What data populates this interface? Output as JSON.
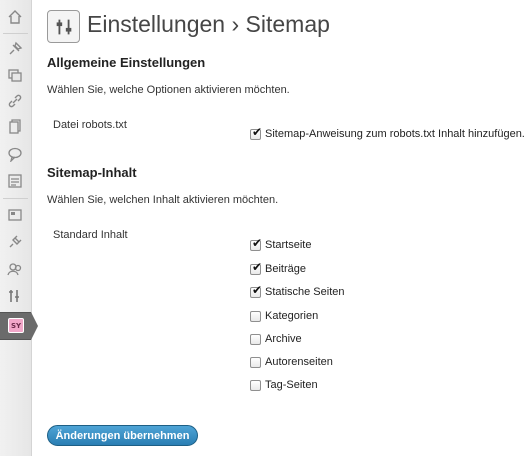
{
  "header": {
    "title": "Einstellungen › Sitemap",
    "icon": "sliders-icon"
  },
  "sidebar": {
    "items": [
      {
        "name": "dashboard",
        "icon": "home-icon"
      },
      {
        "name": "posts",
        "icon": "pin-icon"
      },
      {
        "name": "media",
        "icon": "media-icon"
      },
      {
        "name": "links",
        "icon": "link-icon"
      },
      {
        "name": "pages",
        "icon": "pages-icon"
      },
      {
        "name": "comments",
        "icon": "comment-icon"
      },
      {
        "name": "forms",
        "icon": "form-icon"
      },
      {
        "name": "appearance",
        "icon": "appearance-icon"
      },
      {
        "name": "plugins",
        "icon": "plugin-icon"
      },
      {
        "name": "users",
        "icon": "users-icon"
      },
      {
        "name": "tools",
        "icon": "tools-icon"
      },
      {
        "name": "settings",
        "icon": "settings-icon",
        "active": true
      }
    ]
  },
  "general": {
    "title": "Allgemeine Einstellungen",
    "description": "Wählen Sie, welche Optionen aktivieren möchten.",
    "robots_label": "Datei robots.txt",
    "robots_option": {
      "label": "Sitemap-Anweisung zum robots.txt Inhalt hinzufügen.",
      "checked": true
    }
  },
  "content": {
    "title": "Sitemap-Inhalt",
    "description": "Wählen Sie, welchen Inhalt aktivieren möchten.",
    "standard_label": "Standard Inhalt",
    "options": [
      {
        "label": "Startseite",
        "checked": true
      },
      {
        "label": "Beiträge",
        "checked": true
      },
      {
        "label": "Statische Seiten",
        "checked": true
      },
      {
        "label": "Kategorien",
        "checked": false
      },
      {
        "label": "Archive",
        "checked": false
      },
      {
        "label": "Autorenseiten",
        "checked": false
      },
      {
        "label": "Tag-Seiten",
        "checked": false
      }
    ]
  },
  "submit_label": "Änderungen übernehmen",
  "colors": {
    "accent": "#2a7eb3",
    "active_menu": "#6b6b6b"
  }
}
